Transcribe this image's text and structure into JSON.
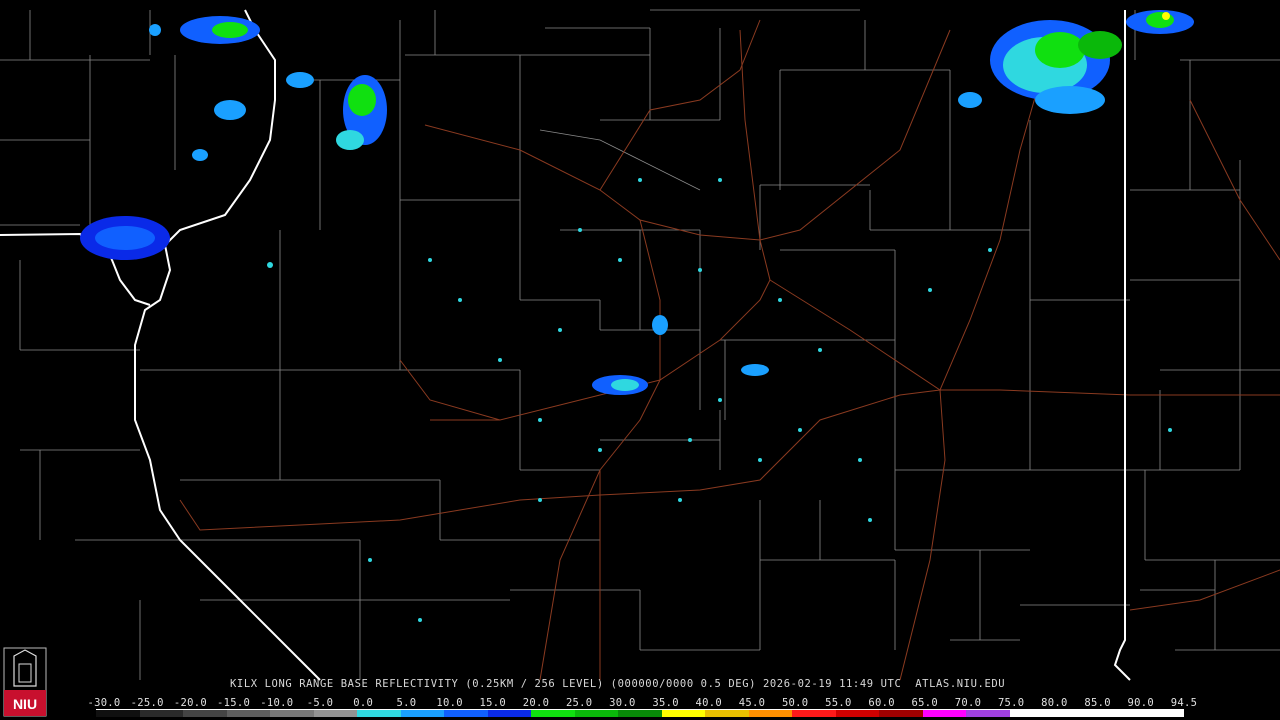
{
  "caption": {
    "text": "KILX LONG RANGE BASE REFLECTIVITY (0.25KM / 256 LEVEL) (000000/0000 0.5 DEG) 2026-02-19 11:49 UTC  ATLAS.NIU.EDU"
  },
  "legend": {
    "labels": [
      "-30.0",
      "-25.0",
      "-20.0",
      "-15.0",
      "-10.0",
      "-5.0",
      "0.0",
      "5.0",
      "10.0",
      "15.0",
      "20.0",
      "25.0",
      "30.0",
      "35.0",
      "40.0",
      "45.0",
      "50.0",
      "55.0",
      "60.0",
      "65.0",
      "70.0",
      "75.0",
      "80.0",
      "85.0",
      "90.0",
      "94.5"
    ],
    "colors": [
      "#101010",
      "#2a2a2a",
      "#444444",
      "#5e5e5e",
      "#787878",
      "#929292",
      "#2fd8e0",
      "#1aa0ff",
      "#1060ff",
      "#0a2ae8",
      "#10e010",
      "#0ab80a",
      "#088a08",
      "#ffff00",
      "#e8c000",
      "#ff9000",
      "#ff1a1a",
      "#d00000",
      "#a00000",
      "#ff00ff",
      "#a040e0",
      "#ffffff",
      "#ffffff",
      "#ffffff",
      "#ffffff"
    ]
  },
  "logo": {
    "text": "NIU",
    "color": "#c8102e"
  }
}
